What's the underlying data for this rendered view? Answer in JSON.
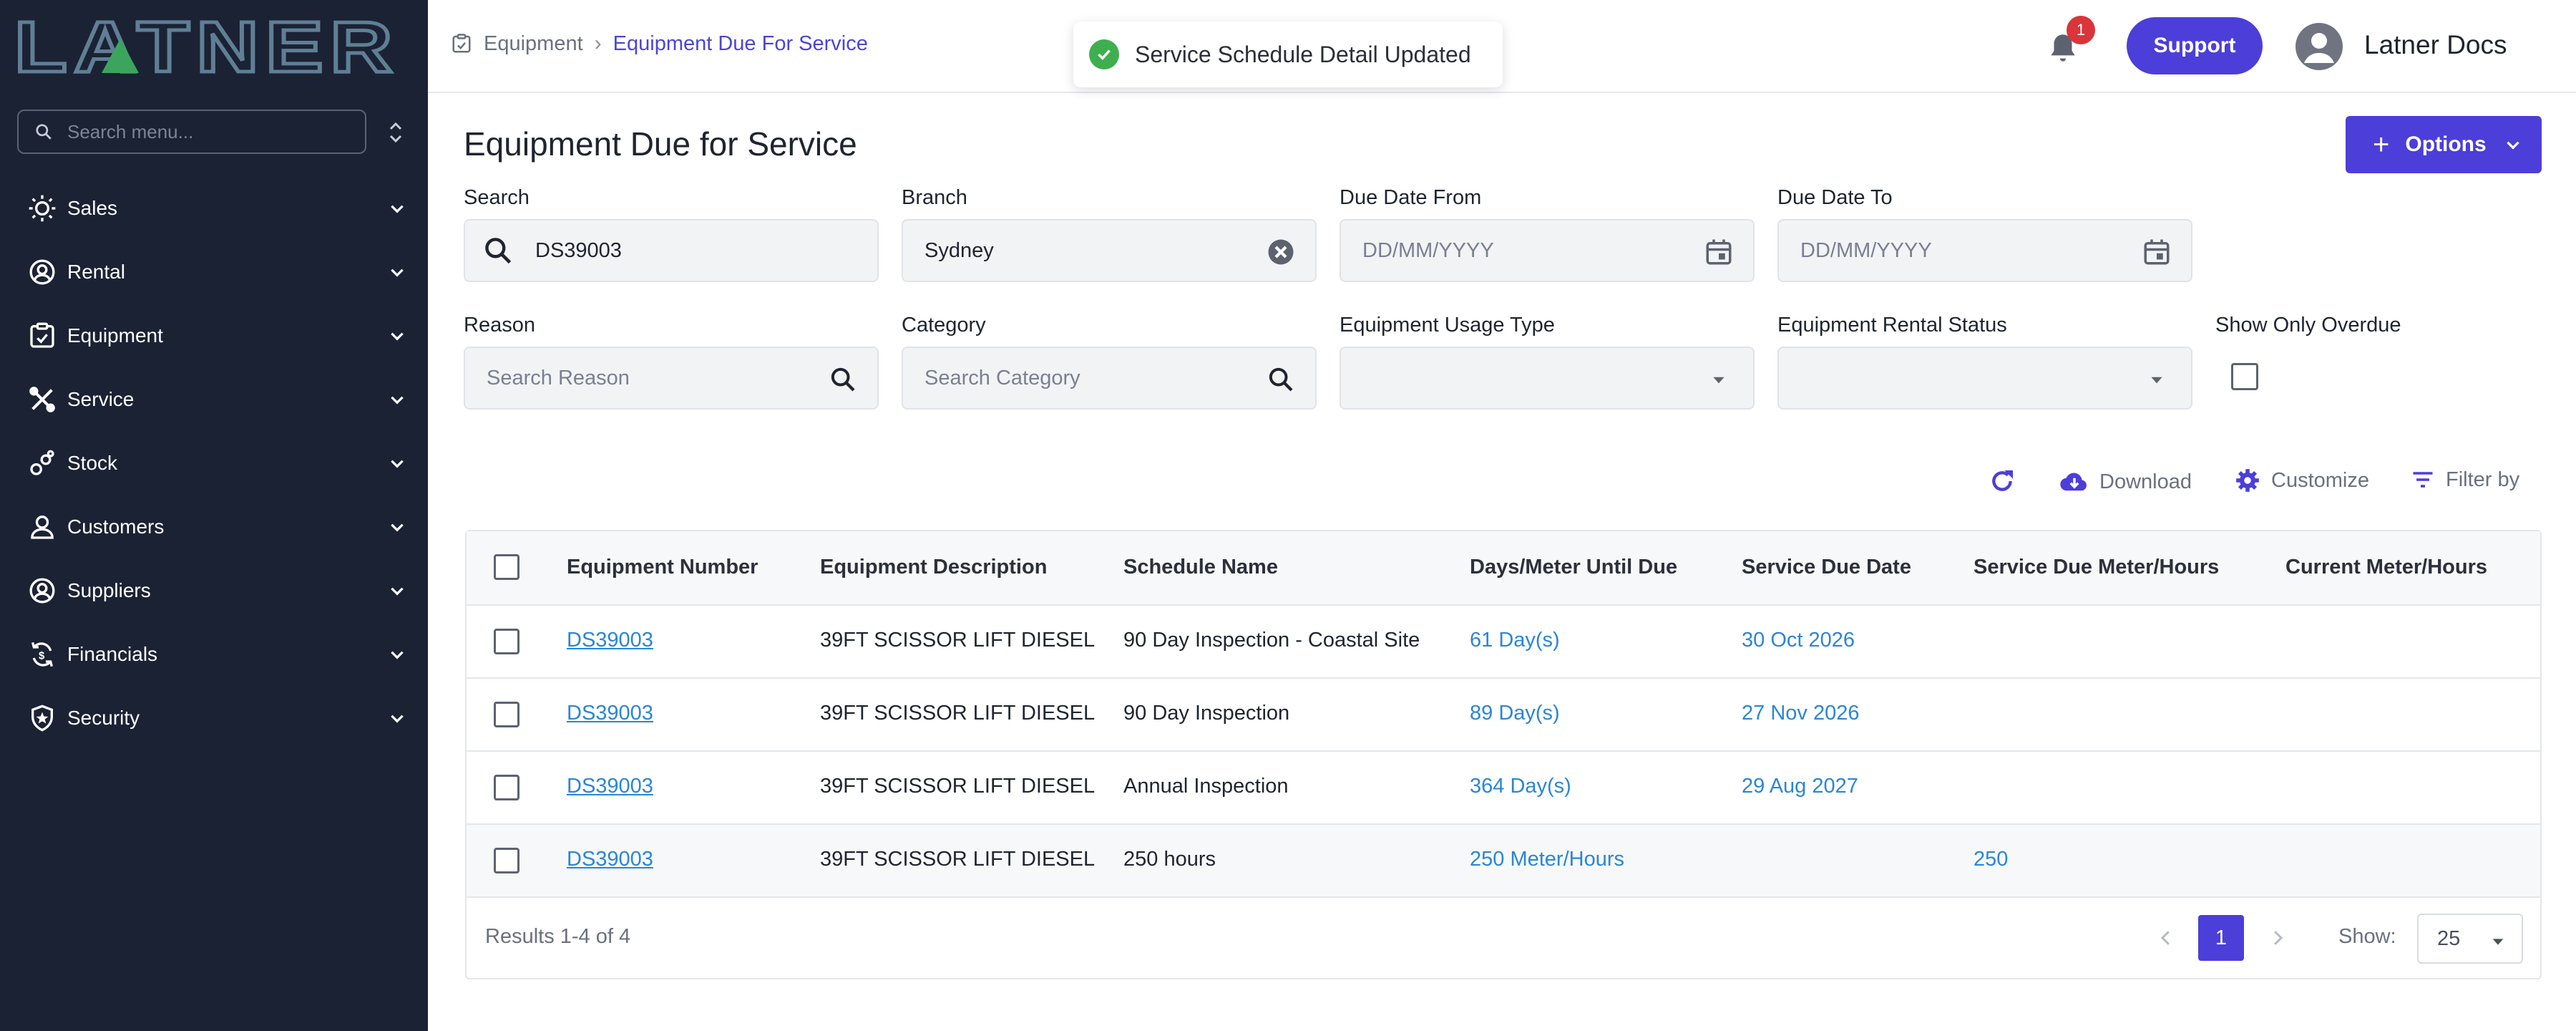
{
  "app": {
    "logo_text": "LATNER"
  },
  "sidebar": {
    "search_placeholder": "Search menu...",
    "items": [
      {
        "label": "Sales",
        "icon": "sales-icon"
      },
      {
        "label": "Rental",
        "icon": "rental-icon"
      },
      {
        "label": "Equipment",
        "icon": "equipment-icon"
      },
      {
        "label": "Service",
        "icon": "service-icon"
      },
      {
        "label": "Stock",
        "icon": "stock-icon"
      },
      {
        "label": "Customers",
        "icon": "person-icon"
      },
      {
        "label": "Suppliers",
        "icon": "suppliers-icon"
      },
      {
        "label": "Financials",
        "icon": "financials-icon"
      },
      {
        "label": "Security",
        "icon": "shield-icon"
      }
    ]
  },
  "header": {
    "breadcrumb": [
      "Equipment",
      "Equipment Due For Service"
    ],
    "toast": "Service Schedule Detail Updated",
    "notification_count": "1",
    "support_label": "Support",
    "user_name": "Latner Docs"
  },
  "page": {
    "title": "Equipment Due for Service",
    "options_label": "Options"
  },
  "filters": {
    "search": {
      "label": "Search",
      "value": "DS39003"
    },
    "branch": {
      "label": "Branch",
      "value": "Sydney"
    },
    "due_from": {
      "label": "Due Date From",
      "placeholder": "DD/MM/YYYY"
    },
    "due_to": {
      "label": "Due Date To",
      "placeholder": "DD/MM/YYYY"
    },
    "reason": {
      "label": "Reason",
      "placeholder": "Search Reason"
    },
    "category": {
      "label": "Category",
      "placeholder": "Search Category"
    },
    "usage_type": {
      "label": "Equipment Usage Type",
      "value": ""
    },
    "rental_status": {
      "label": "Equipment Rental Status",
      "value": ""
    },
    "overdue": {
      "label": "Show Only Overdue",
      "checked": false
    }
  },
  "toolbar": {
    "download": "Download",
    "customize": "Customize",
    "filter_by": "Filter by"
  },
  "table": {
    "columns": [
      "Equipment Number",
      "Equipment Description",
      "Schedule Name",
      "Days/Meter Until Due",
      "Service Due Date",
      "Service Due Meter/Hours",
      "Current Meter/Hours"
    ],
    "rows": [
      {
        "number": "DS39003",
        "description": "39FT SCISSOR LIFT DIESEL",
        "schedule": "90 Day Inspection - Coastal Site",
        "until_due": "61 Day(s)",
        "due_date": "30 Oct 2026",
        "due_meter": "",
        "current_meter": ""
      },
      {
        "number": "DS39003",
        "description": "39FT SCISSOR LIFT DIESEL",
        "schedule": "90 Day Inspection",
        "until_due": "89 Day(s)",
        "due_date": "27 Nov 2026",
        "due_meter": "",
        "current_meter": ""
      },
      {
        "number": "DS39003",
        "description": "39FT SCISSOR LIFT DIESEL",
        "schedule": "Annual Inspection",
        "until_due": "364 Day(s)",
        "due_date": "29 Aug 2027",
        "due_meter": "",
        "current_meter": ""
      },
      {
        "number": "DS39003",
        "description": "39FT SCISSOR LIFT DIESEL",
        "schedule": "250 hours",
        "until_due": "250 Meter/Hours",
        "due_date": "",
        "due_meter": "250",
        "current_meter": ""
      }
    ],
    "results_text": "Results 1-4 of 4",
    "current_page": "1",
    "show_label": "Show:",
    "page_size": "25"
  },
  "colors": {
    "accent": "#4c3ed9",
    "sidebar": "#1b2234",
    "link": "#2a86d6",
    "success": "#3fae4f"
  }
}
